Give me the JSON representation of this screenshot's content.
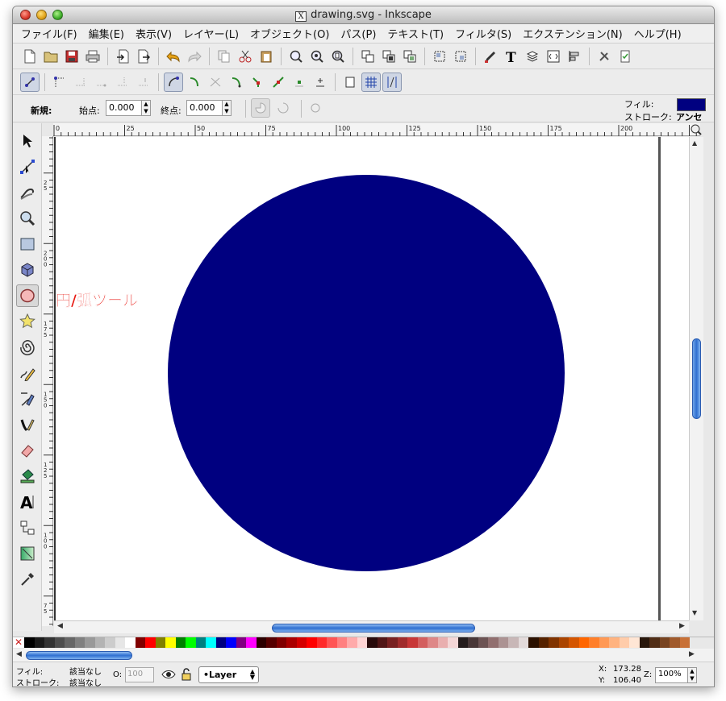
{
  "window": {
    "title": "drawing.svg - Inkscape",
    "title_icon": "X"
  },
  "menu": [
    "ファイル(F)",
    "編集(E)",
    "表示(V)",
    "レイヤー(L)",
    "オブジェクト(O)",
    "パス(P)",
    "テキスト(T)",
    "フィルタ(S)",
    "エクステンション(N)",
    "ヘルプ(H)"
  ],
  "ctrl": {
    "new_label": "新規:",
    "start_label": "始点:",
    "start_value": "0.000",
    "end_label": "終点:",
    "end_value": "0.000",
    "fill_label": "フィル:",
    "stroke_label": "ストローク:",
    "stroke_value": "アンセ"
  },
  "ruler": {
    "h_ticks": [
      "0",
      "25",
      "50",
      "75",
      "100",
      "125",
      "150",
      "175",
      "200"
    ],
    "v_ticks": [
      "2 5",
      "2 0 0",
      "1 7 5",
      "1 5 0",
      "1 2 5",
      "1 0 0",
      "7 5"
    ]
  },
  "annotation": {
    "text": "円/弧ツール"
  },
  "canvas": {
    "shape": "circle",
    "fill_color": "#000080"
  },
  "status": {
    "fill_label": "フィル:",
    "fill_value": "該当なし",
    "stroke_label": "ストローク:",
    "stroke_value": "該当なし",
    "opacity_label": "O:",
    "opacity_value": "100",
    "layer": "•Layer",
    "x_label": "X:",
    "x_value": "173.28",
    "y_label": "Y:",
    "y_value": "106.40",
    "zoom_label": "Z:",
    "zoom_value": "100%"
  },
  "palette_colors": [
    "#000000",
    "#1a1a1a",
    "#333333",
    "#4d4d4d",
    "#666666",
    "#808080",
    "#999999",
    "#b3b3b3",
    "#cccccc",
    "#e6e6e6",
    "#ffffff",
    "#800000",
    "#ff0000",
    "#808000",
    "#ffff00",
    "#008000",
    "#00ff00",
    "#008080",
    "#00ffff",
    "#000080",
    "#0000ff",
    "#800080",
    "#ff00ff",
    "#2b0000",
    "#550000",
    "#800000",
    "#aa0000",
    "#d40000",
    "#ff0000",
    "#ff2a2a",
    "#ff5555",
    "#ff8080",
    "#ffaaaa",
    "#ffd5d5",
    "#280b0b",
    "#501616",
    "#782121",
    "#a02c2c",
    "#c83737",
    "#d35f5f",
    "#de8787",
    "#e9afaf",
    "#f4d7d7",
    "#241c1c",
    "#483737",
    "#6c5353",
    "#916f6f",
    "#ac9393",
    "#c8b7b7",
    "#e3dbdb",
    "#2b1100",
    "#552200",
    "#803300",
    "#aa4400",
    "#d45500",
    "#ff6600",
    "#ff7f2a",
    "#ff9955",
    "#ffb380",
    "#ffccaa",
    "#ffe6d5",
    "#28170b",
    "#502d16",
    "#784421",
    "#a05a2c",
    "#c87137"
  ]
}
